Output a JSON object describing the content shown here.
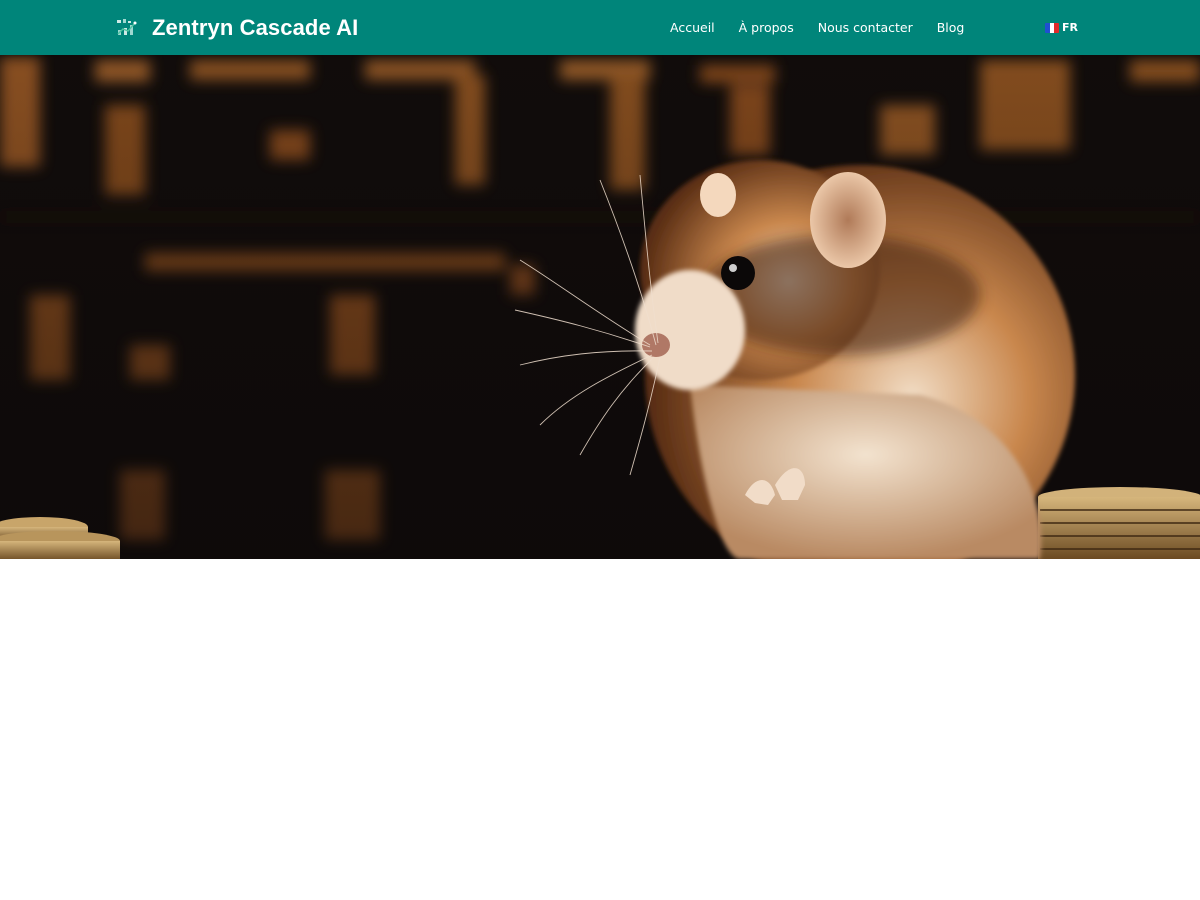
{
  "header": {
    "brand_name": "Zentryn Cascade AI",
    "logo_icon": "chart-logo-icon",
    "nav": [
      {
        "label": "Accueil"
      },
      {
        "label": "À propos"
      },
      {
        "label": "Nous contacter"
      },
      {
        "label": "Blog"
      }
    ],
    "language": {
      "code": "FR",
      "flag_icon": "france-flag-icon"
    }
  },
  "hero": {
    "image_icon": "hamster-coins-image"
  },
  "colors": {
    "header_bg": "#00857a",
    "header_text": "#ffffff",
    "page_bg": "#ffffff"
  }
}
